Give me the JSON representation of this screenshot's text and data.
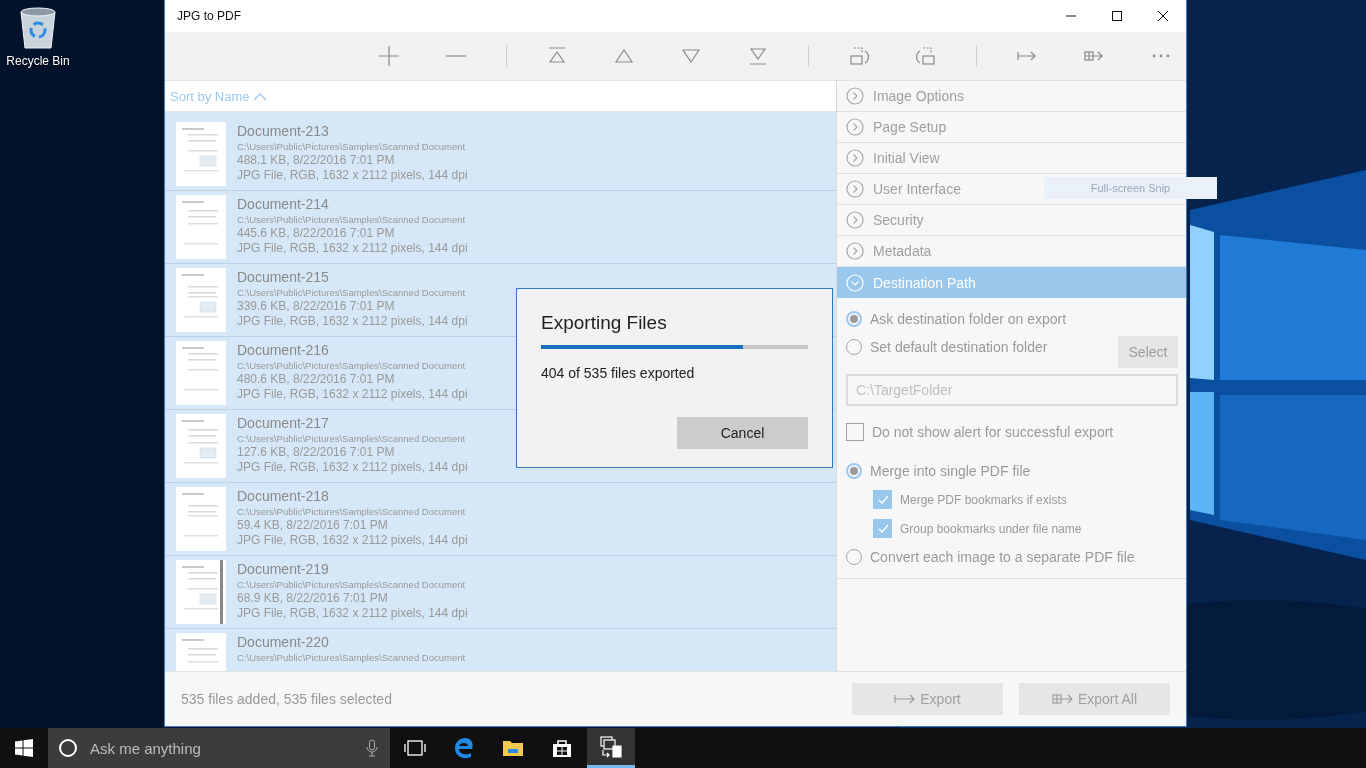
{
  "desktop": {
    "icons": [
      {
        "label": "Recycle Bin"
      }
    ]
  },
  "window": {
    "title": "JPG to PDF"
  },
  "list": {
    "sort_label": "Sort by Name",
    "items": [
      {
        "name": "Document-213",
        "path": "C:\\Users\\Public\\Pictures\\Samples\\Scanned Document",
        "size_date": "488.1 KB, 8/22/2016 7:01 PM",
        "details": "JPG File, RGB, 1632 x 2112 pixels, 144 dpi",
        "selected": true
      },
      {
        "name": "Document-214",
        "path": "C:\\Users\\Public\\Pictures\\Samples\\Scanned Document",
        "size_date": "445.6 KB, 8/22/2016 7:01 PM",
        "details": "JPG File, RGB, 1632 x 2112 pixels, 144 dpi",
        "selected": true
      },
      {
        "name": "Document-215",
        "path": "C:\\Users\\Public\\Pictures\\Samples\\Scanned Document",
        "size_date": "339.6 KB, 8/22/2016 7:01 PM",
        "details": "JPG File, RGB, 1632 x 2112 pixels, 144 dpi",
        "selected": true
      },
      {
        "name": "Document-216",
        "path": "C:\\Users\\Public\\Pictures\\Samples\\Scanned Document",
        "size_date": "480.6 KB, 8/22/2016 7:01 PM",
        "details": "JPG File, RGB, 1632 x 2112 pixels, 144 dpi",
        "selected": true
      },
      {
        "name": "Document-217",
        "path": "C:\\Users\\Public\\Pictures\\Samples\\Scanned Document",
        "size_date": "127.6 KB, 8/22/2016 7:01 PM",
        "details": "JPG File, RGB, 1632 x 2112 pixels, 144 dpi",
        "selected": true
      },
      {
        "name": "Document-218",
        "path": "C:\\Users\\Public\\Pictures\\Samples\\Scanned Document",
        "size_date": "59.4 KB, 8/22/2016 7:01 PM",
        "details": "JPG File, RGB, 1632 x 2112 pixels, 144 dpi",
        "selected": true
      },
      {
        "name": "Document-219",
        "path": "C:\\Users\\Public\\Pictures\\Samples\\Scanned Document",
        "size_date": "68.9 KB, 8/22/2016 7:01 PM",
        "details": "JPG File, RGB, 1632 x 2112 pixels, 144 dpi",
        "selected": true
      },
      {
        "name": "Document-220",
        "path": "C:\\Users\\Public\\Pictures\\Samples\\Scanned Document",
        "selected": true
      }
    ]
  },
  "panel": {
    "sections": [
      {
        "label": "Image Options",
        "expanded": false
      },
      {
        "label": "Page Setup",
        "expanded": false
      },
      {
        "label": "Initial View",
        "expanded": false
      },
      {
        "label": "User Interface",
        "expanded": false
      },
      {
        "label": "Security",
        "expanded": false
      },
      {
        "label": "Metadata",
        "expanded": false
      },
      {
        "label": "Destination Path",
        "expanded": true
      }
    ],
    "destination": {
      "folder_choice": [
        {
          "label": "Ask destination folder on export",
          "selected": true
        },
        {
          "label": "Set default destination folder",
          "selected": false
        }
      ],
      "select_button": "Select",
      "folder_field": {
        "placeholder": "C:\\TargetFolder"
      },
      "no_alert": {
        "label": "Do not show alert for successful export",
        "checked": false
      },
      "output_mode": [
        {
          "label": "Merge into single PDF file",
          "selected": true,
          "children": [
            {
              "label": "Merge PDF bookmarks if exists",
              "checked": true
            },
            {
              "label": "Group bookmarks under file name",
              "checked": true
            }
          ]
        },
        {
          "label": "Convert each image to a separate PDF file",
          "selected": false
        }
      ]
    }
  },
  "overlay_hint": "Full-screen Snip",
  "dialog": {
    "title": "Exporting Files",
    "level": 0.755,
    "status": "404 of 535 files exported",
    "button": "Cancel"
  },
  "status_bar": {
    "text": "535 files added, 535 files selected",
    "buttons": [
      "Export",
      "Export All"
    ]
  },
  "taskbar": {
    "search": {
      "placeholder": "Ask me anything"
    }
  }
}
